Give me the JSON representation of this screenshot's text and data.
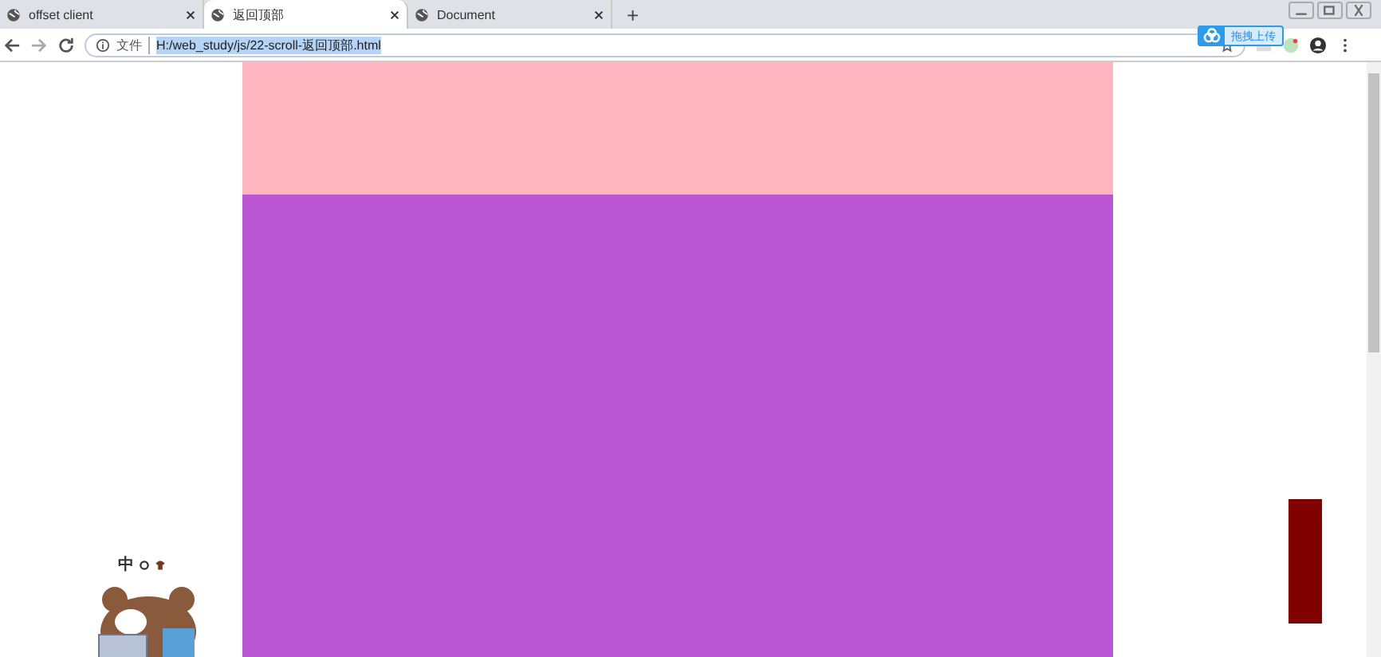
{
  "tabs": [
    {
      "title": "offset client",
      "selected": false
    },
    {
      "title": "返回顶部",
      "selected": true
    },
    {
      "title": "Document",
      "selected": false
    }
  ],
  "new_tab": "+",
  "address_bar": {
    "scheme_label": "文件",
    "url": "H:/web_study/js/22-scroll-返回顶部.html",
    "selected": true
  },
  "upload_button": {
    "label": "拖拽上传"
  },
  "page": {
    "blocks": [
      {
        "color": "#ffb6c1"
      },
      {
        "color": "#ba55d3"
      }
    ],
    "back_to_top": {
      "color": "#800000"
    }
  },
  "ime": {
    "mode": "中"
  }
}
